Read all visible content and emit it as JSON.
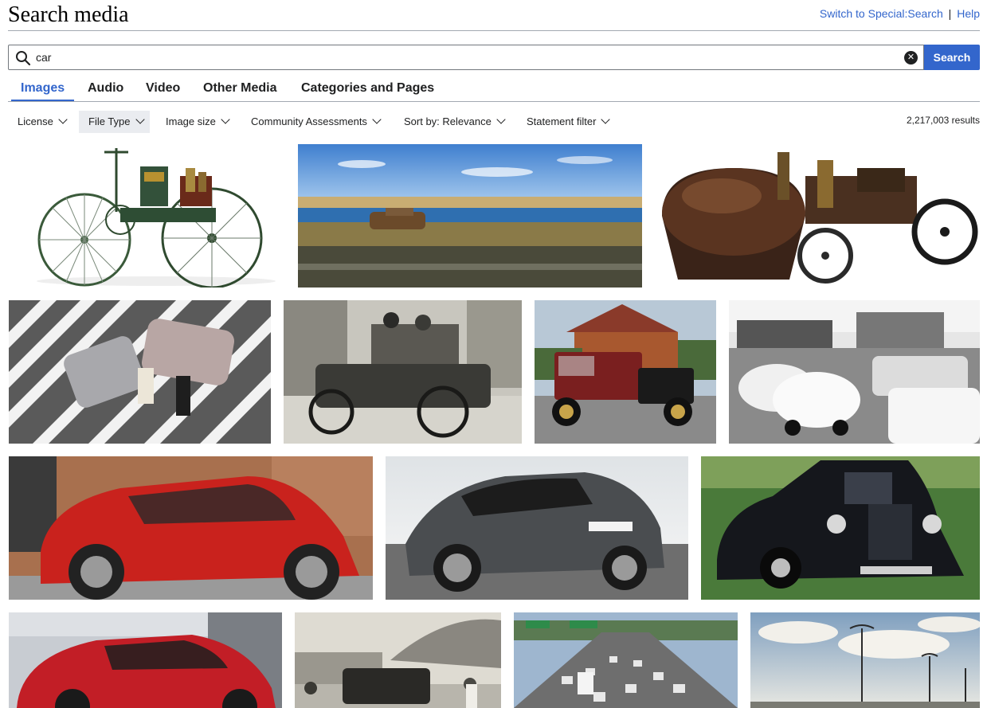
{
  "page": {
    "title": "Search media"
  },
  "top_links": {
    "special_search": "Switch to Special:Search",
    "separator": "|",
    "help": "Help"
  },
  "search": {
    "value": "car",
    "button_label": "Search"
  },
  "tabs": [
    {
      "label": "Images",
      "active": true
    },
    {
      "label": "Audio",
      "active": false
    },
    {
      "label": "Video",
      "active": false
    },
    {
      "label": "Other Media",
      "active": false
    },
    {
      "label": "Categories and Pages",
      "active": false
    }
  ],
  "filters": [
    {
      "label": "License"
    },
    {
      "label": "File Type"
    },
    {
      "label": "Image size"
    },
    {
      "label": "Community Assessments"
    },
    {
      "label": "Sort by: Relevance"
    },
    {
      "label": "Statement filter"
    }
  ],
  "results_count": "2,217,003 results",
  "images": [
    {
      "subject": "green three-wheeled antique motorwagen on white background"
    },
    {
      "subject": "rusted car wreck beside a lake under blue sky"
    },
    {
      "subject": "antique steam vehicle with large copper boiler"
    },
    {
      "subject": "two cars collided on a zebra crossing, people standing nearby"
    },
    {
      "subject": "black and white photo of early open car with passengers"
    },
    {
      "subject": "red and black vintage Ford sedan in front of a lodge"
    },
    {
      "subject": "black and white photo of parked beetles and cars at a port"
    },
    {
      "subject": "red compact hatchback parked by a brick building"
    },
    {
      "subject": "grey sports coupe with plate 1100 HMY on a road"
    },
    {
      "subject": "black vintage sedan on grass with plate Traction"
    },
    {
      "subject": "red electric sedan on a street"
    },
    {
      "subject": "black and white photo of crowd and early car near a building"
    },
    {
      "subject": "heavy traffic on a multilane highway"
    },
    {
      "subject": "highway with street lamps under cloudy sky"
    }
  ],
  "colors": {
    "link": "#3366cc",
    "button": "#3366cc",
    "border": "#a2a9b1"
  }
}
